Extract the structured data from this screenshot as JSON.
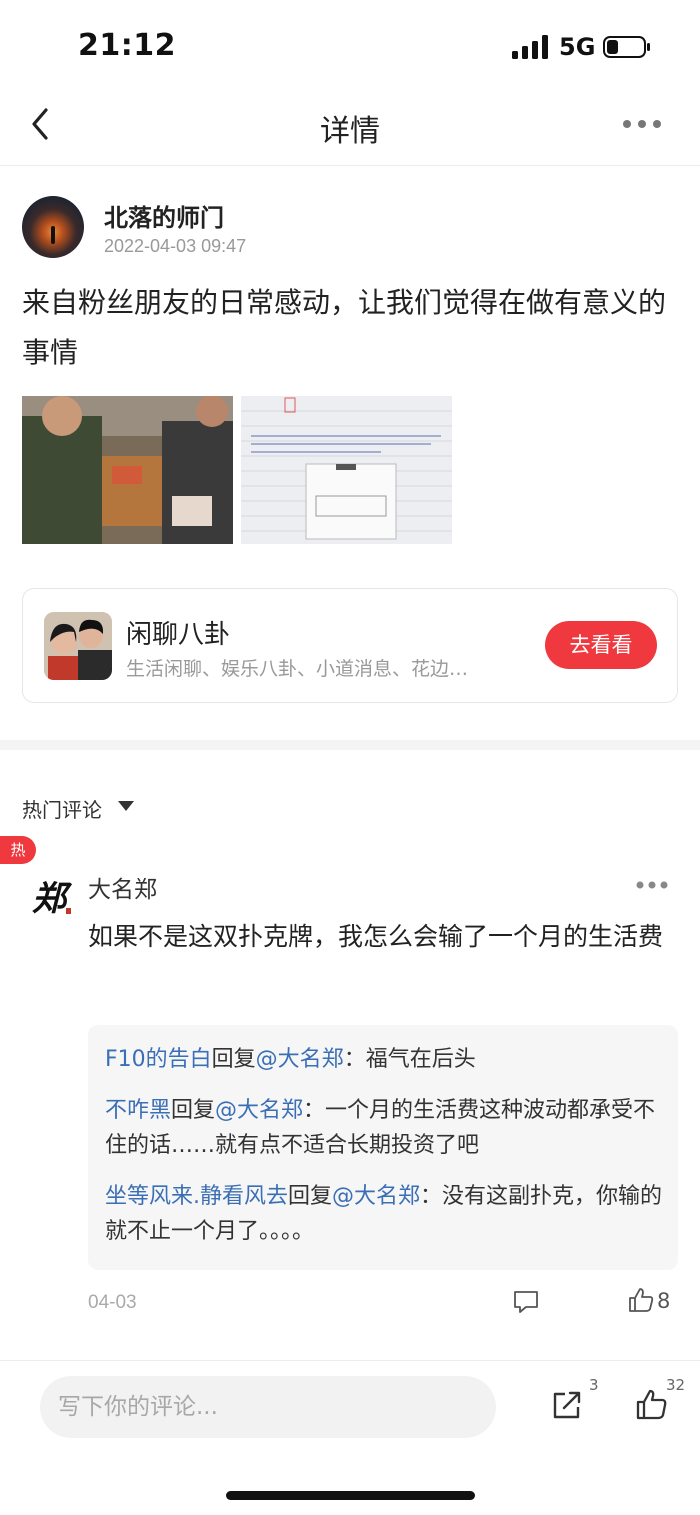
{
  "status_bar": {
    "time": "21:12",
    "network": "5G"
  },
  "nav": {
    "title": "详情"
  },
  "post": {
    "author": "北落的师门",
    "time": "2022-04-03 09:47",
    "text": "来自粉丝朋友的日常感动，让我们觉得在做有意义的事情"
  },
  "circle_card": {
    "title": "闲聊八卦",
    "description": "生活闲聊、娱乐八卦、小道消息、花边…",
    "button_label": "去看看"
  },
  "comments_section": {
    "title": "热门评论",
    "hot_badge": "热",
    "comment": {
      "avatar_char": "郑",
      "name": "大名郑",
      "text": "如果不是这双扑克牌，我怎么会输了一个月的生活费",
      "date": "04-03",
      "like_count": "8",
      "replies": [
        {
          "user": "F10的告白",
          "verb": "回复",
          "target": "@大名郑",
          "text": "：福气在后头"
        },
        {
          "user": "不咋黑",
          "verb": "回复",
          "target": "@大名郑",
          "text": "：一个月的生活费这种波动都承受不住的话……就有点不适合长期投资了吧"
        },
        {
          "user": "坐等风来.静看风去",
          "verb": "回复",
          "target": "@大名郑",
          "text": "：没有这副扑克，你输的就不止一个月了。。。。"
        }
      ]
    }
  },
  "bottom_bar": {
    "placeholder": "写下你的评论...",
    "share_count": "3",
    "like_count": "32"
  },
  "colors": {
    "accent": "#f0393f",
    "link": "#3b6fb5"
  }
}
